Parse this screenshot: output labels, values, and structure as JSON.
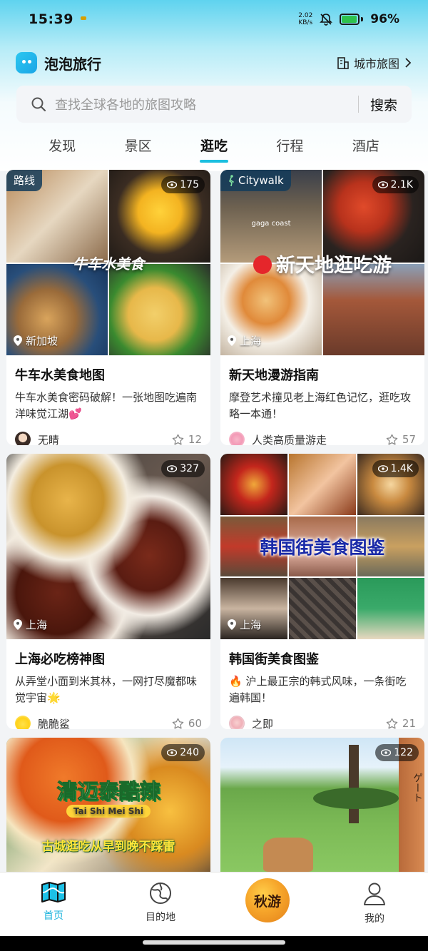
{
  "status_bar": {
    "time": "15:39",
    "net_speed_value": "2.02",
    "net_speed_unit": "KB/s",
    "battery_percent": "96%"
  },
  "header": {
    "app_name": "泡泡旅行",
    "city_map_label": "城市旅图"
  },
  "search": {
    "placeholder": "查找全球各地的旅图攻略",
    "button_label": "搜索"
  },
  "tabs": [
    {
      "label": "发现"
    },
    {
      "label": "景区"
    },
    {
      "label": "逛吃"
    },
    {
      "label": "行程"
    },
    {
      "label": "酒店"
    }
  ],
  "cards": [
    {
      "tag": "路线",
      "views": "175",
      "location": "新加坡",
      "overlay": "牛车水美食",
      "title": "牛车水美食地图",
      "desc": "牛车水美食密码破解！一张地图吃遍南洋味觉江湖💕",
      "author": "无睛",
      "likes": "12"
    },
    {
      "tag": "Citywalk",
      "views": "2.1K",
      "location": "上海",
      "overlay": "新天地逛吃游",
      "sign": "gaga coast",
      "title": "新天地漫游指南",
      "desc": "摩登艺术撞见老上海红色记忆，逛吃攻略一本通！",
      "author": "人类高质量游走",
      "likes": "57"
    },
    {
      "views": "327",
      "location": "上海",
      "title": "上海必吃榜神图",
      "desc": "从弄堂小面到米其林，一网打尽魔都味觉宇宙🌟",
      "author": "脆脆鲨",
      "likes": "60"
    },
    {
      "views": "1.4K",
      "location": "上海",
      "overlay": "韩国街美食图鉴",
      "title": "韩国街美食图鉴",
      "desc": "🔥 沪上最正宗的韩式风味，一条街吃遍韩国！",
      "author": "之即",
      "likes": "21"
    },
    {
      "views": "240",
      "overlay": "清迈泰酷辣",
      "overlay_sub": "Tai Shi Mei Shi",
      "overlay_bottom": "古城逛吃从早到晚不踩雷"
    },
    {
      "views": "122",
      "overlay": "ゲート"
    }
  ],
  "bottom_nav": [
    {
      "label": "首页"
    },
    {
      "label": "目的地"
    },
    {
      "label": "秋游"
    },
    {
      "label": "我的"
    }
  ],
  "colors": {
    "accent": "#1bbfe0",
    "tag_bg": "#143c5a"
  }
}
